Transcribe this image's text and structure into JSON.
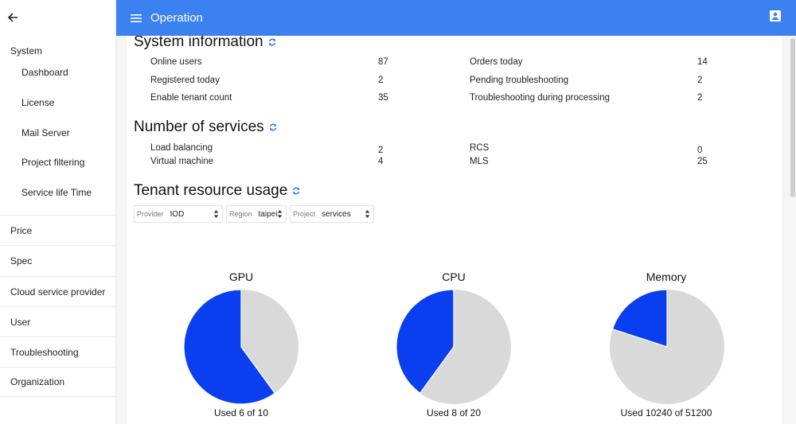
{
  "sidebar": {
    "group_label": "System",
    "sub_items": [
      {
        "label": "Dashboard"
      },
      {
        "label": "License"
      },
      {
        "label": "Mail Server"
      },
      {
        "label": "Project filtering"
      },
      {
        "label": "Service life Time"
      }
    ],
    "items": [
      {
        "label": "Price"
      },
      {
        "label": "Spec"
      },
      {
        "label": "Cloud service provider"
      },
      {
        "label": "User"
      },
      {
        "label": "Troubleshooting"
      },
      {
        "label": "Organization"
      }
    ]
  },
  "header": {
    "title": "Operation",
    "color": "#3b82f0"
  },
  "system_info": {
    "title": "System information",
    "rows": [
      {
        "label": "Online users",
        "value": "87"
      },
      {
        "label": "Registered today",
        "value": "2"
      },
      {
        "label": "Enable tenant count",
        "value": "35"
      },
      {
        "label": "Orders today",
        "value": "14"
      },
      {
        "label": "Pending troubleshooting",
        "value": "2"
      },
      {
        "label": "Troubleshooting during processing",
        "value": "2"
      }
    ]
  },
  "services": {
    "title": "Number of services",
    "rows": [
      {
        "label": "Load balancing",
        "value": "2"
      },
      {
        "label": "Virtual machine",
        "value": "4"
      },
      {
        "label": "RCS",
        "value": "0"
      },
      {
        "label": "MLS",
        "value": "25"
      }
    ]
  },
  "tenant_usage": {
    "title": "Tenant resource usage",
    "filters": [
      {
        "prefix": "Provider",
        "value": "IOD"
      },
      {
        "prefix": "Region",
        "value": "taipei"
      },
      {
        "prefix": "Project",
        "value": "services"
      }
    ],
    "charts": [
      {
        "title": "GPU",
        "used": 6,
        "total": 10,
        "caption": "Used 6 of 10"
      },
      {
        "title": "CPU",
        "used": 8,
        "total": 20,
        "caption": "Used 8 of 20"
      },
      {
        "title": "Memory",
        "used": 10240,
        "total": 51200,
        "caption": "Used 10240 of 51200"
      }
    ],
    "colors": {
      "used": "#0a3ff0",
      "free": "#d9d9d9"
    }
  },
  "icons": {
    "back": "arrow-left-icon",
    "menu": "hamburger-menu-icon",
    "account": "account-box-icon",
    "refresh": "refresh-icon",
    "select": "chevron-up-down-icon"
  }
}
